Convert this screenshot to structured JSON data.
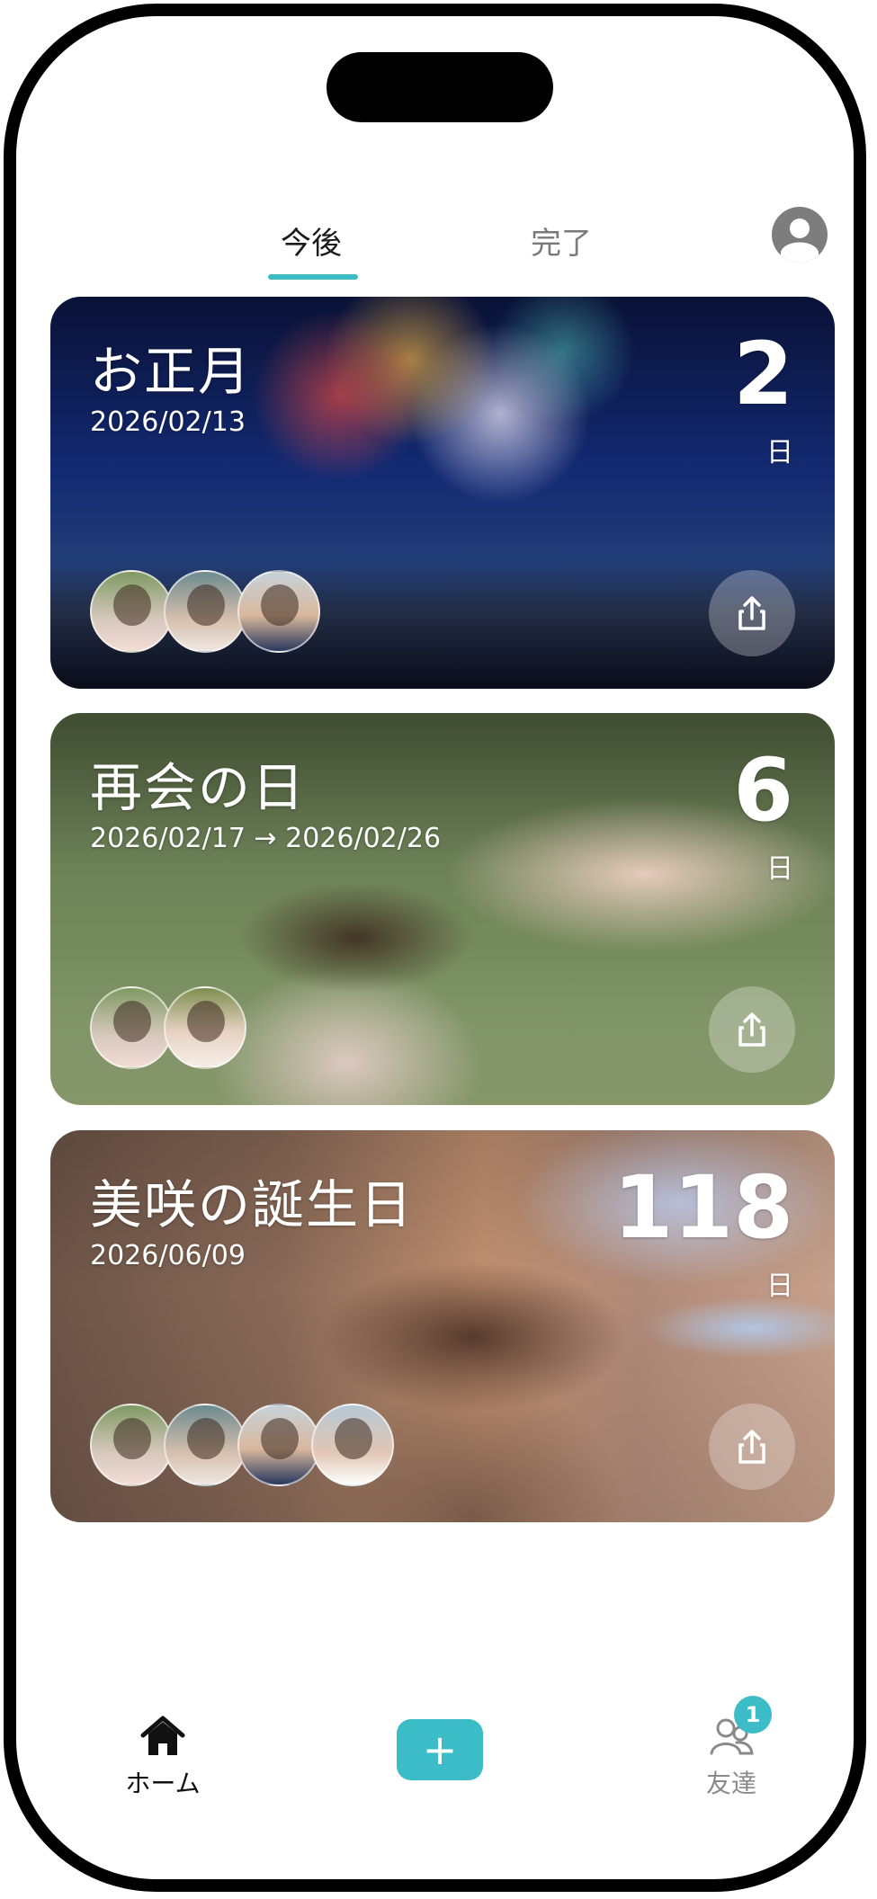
{
  "tabs": {
    "upcoming": "今後",
    "done": "完了",
    "active_color": "#3cbcc6"
  },
  "header": {
    "profile_icon": "user-circle-icon"
  },
  "events": [
    {
      "title": "お正月",
      "date": "2026/02/13",
      "count": "2",
      "unit": "日",
      "avatar_count": 3
    },
    {
      "title": "再会の日",
      "date": "2026/02/17 → 2026/02/26",
      "count": "6",
      "unit": "日",
      "avatar_count": 2
    },
    {
      "title": "美咲の誕生日",
      "date": "2026/06/09",
      "count": "118",
      "unit": "日",
      "avatar_count": 4
    }
  ],
  "bottom_nav": {
    "home_label": "ホーム",
    "add_label": "+",
    "friends_label": "友達",
    "friends_badge": "1",
    "home_icon": "home-icon",
    "friends_icon": "friends-icon"
  }
}
